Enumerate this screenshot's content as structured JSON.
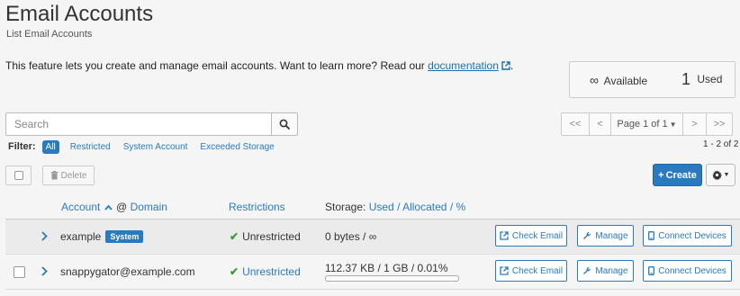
{
  "header": {
    "title": "Email Accounts",
    "subtitle": "List Email Accounts"
  },
  "intro": {
    "text": "This feature lets you create and manage email accounts. Want to learn more? Read our ",
    "link_label": "documentation",
    "suffix": "."
  },
  "stats": {
    "available_symbol": "∞",
    "available_label": "Available",
    "used_count": "1",
    "used_label": "Used"
  },
  "search": {
    "placeholder": "Search",
    "value": ""
  },
  "filter": {
    "label": "Filter:",
    "items": [
      "All",
      "Restricted",
      "System Account",
      "Exceeded Storage"
    ],
    "active": "All"
  },
  "pagination": {
    "first": "<<",
    "prev": "<",
    "page_label": "Page 1 of 1",
    "next": ">",
    "last": ">>",
    "range": "1 - 2 of 2"
  },
  "toolbar": {
    "delete_label": "Delete",
    "create_label": "Create",
    "create_prefix": "+"
  },
  "table": {
    "headers": {
      "account": "Account",
      "at": "@",
      "domain": "Domain",
      "restrictions": "Restrictions",
      "storage_prefix": "Storage:",
      "used": "Used",
      "sep1": "/",
      "allocated": "Allocated",
      "sep2": "/",
      "percent": "%"
    },
    "rows": [
      {
        "account": "example",
        "badge": "System",
        "restriction": "Unrestricted",
        "storage": "0 bytes / ∞",
        "has_checkbox": false,
        "usage_fraction": null
      },
      {
        "account": "snappygator@example.com",
        "badge": "",
        "restriction": "Unrestricted",
        "storage": "112.37 KB / 1 GB / 0.01%",
        "has_checkbox": true,
        "usage_fraction": 0.0001
      }
    ],
    "actions": {
      "check_email": "Check Email",
      "manage": "Manage",
      "connect_devices": "Connect Devices"
    }
  },
  "colors": {
    "accent": "#2a7ac0",
    "success": "#3c9b3c",
    "background": "#f5f5f5"
  },
  "icons": [
    "external-link-icon",
    "search-icon",
    "trash-icon",
    "gear-icon",
    "chevron-right-icon",
    "checkmark-icon",
    "external-link-icon",
    "wrench-icon",
    "mobile-icon"
  ]
}
